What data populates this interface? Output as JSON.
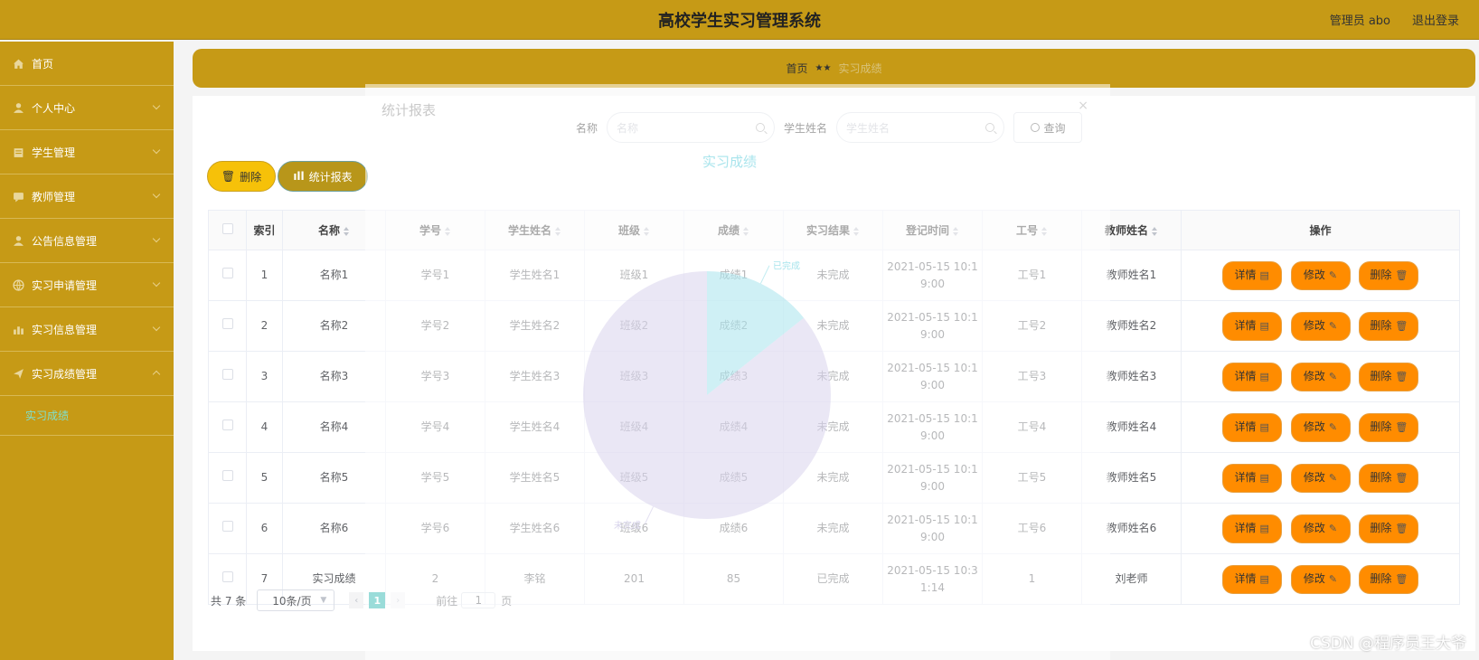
{
  "header": {
    "title": "高校学生实习管理系统",
    "user_label": "管理员 abo",
    "logout_label": "退出登录"
  },
  "sidebar": {
    "items": [
      {
        "label": "首页",
        "icon": "home-icon"
      },
      {
        "label": "个人中心",
        "icon": "user-icon"
      },
      {
        "label": "学生管理",
        "icon": "folder-icon"
      },
      {
        "label": "教师管理",
        "icon": "chat-icon"
      },
      {
        "label": "公告信息管理",
        "icon": "user-icon"
      },
      {
        "label": "实习申请管理",
        "icon": "globe-icon"
      },
      {
        "label": "实习信息管理",
        "icon": "chart-icon"
      },
      {
        "label": "实习成绩管理",
        "icon": "send-icon"
      }
    ],
    "submenu_active": "实习成绩"
  },
  "breadcrumb": {
    "home": "首页",
    "separator": "★★",
    "current": "实习成绩"
  },
  "search": {
    "name_label": "名称",
    "name_placeholder": "名称",
    "student_label": "学生姓名",
    "student_placeholder": "学生姓名",
    "query_button": "查询"
  },
  "toolbar": {
    "delete_label": "删除",
    "stats_label": "统计报表"
  },
  "table": {
    "columns": [
      "索引",
      "名称",
      "学号",
      "学生姓名",
      "班级",
      "成绩",
      "实习结果",
      "登记时间",
      "工号",
      "教师姓名",
      "操作"
    ],
    "rows": [
      {
        "index": "1",
        "name": "名称1",
        "student_no": "学号1",
        "student_name": "学生姓名1",
        "class": "班级1",
        "score": "成绩1",
        "result": "未完成",
        "time_1": "2021-05-15 10:1",
        "time_2": "9:00",
        "staff_no": "工号1",
        "teacher": "教师姓名1"
      },
      {
        "index": "2",
        "name": "名称2",
        "student_no": "学号2",
        "student_name": "学生姓名2",
        "class": "班级2",
        "score": "成绩2",
        "result": "未完成",
        "time_1": "2021-05-15 10:1",
        "time_2": "9:00",
        "staff_no": "工号2",
        "teacher": "教师姓名2"
      },
      {
        "index": "3",
        "name": "名称3",
        "student_no": "学号3",
        "student_name": "学生姓名3",
        "class": "班级3",
        "score": "成绩3",
        "result": "未完成",
        "time_1": "2021-05-15 10:1",
        "time_2": "9:00",
        "staff_no": "工号3",
        "teacher": "教师姓名3"
      },
      {
        "index": "4",
        "name": "名称4",
        "student_no": "学号4",
        "student_name": "学生姓名4",
        "class": "班级4",
        "score": "成绩4",
        "result": "未完成",
        "time_1": "2021-05-15 10:1",
        "time_2": "9:00",
        "staff_no": "工号4",
        "teacher": "教师姓名4"
      },
      {
        "index": "5",
        "name": "名称5",
        "student_no": "学号5",
        "student_name": "学生姓名5",
        "class": "班级5",
        "score": "成绩5",
        "result": "未完成",
        "time_1": "2021-05-15 10:1",
        "time_2": "9:00",
        "staff_no": "工号5",
        "teacher": "教师姓名5"
      },
      {
        "index": "6",
        "name": "名称6",
        "student_no": "学号6",
        "student_name": "学生姓名6",
        "class": "班级6",
        "score": "成绩6",
        "result": "未完成",
        "time_1": "2021-05-15 10:1",
        "time_2": "9:00",
        "staff_no": "工号6",
        "teacher": "教师姓名6"
      },
      {
        "index": "7",
        "name": "实习成绩",
        "student_no": "2",
        "student_name": "李铭",
        "class": "201",
        "score": "85",
        "result": "已完成",
        "time_1": "2021-05-15 10:3",
        "time_2": "1:14",
        "staff_no": "1",
        "teacher": "刘老师"
      }
    ],
    "actions": {
      "detail": "详情",
      "edit": "修改",
      "delete": "删除"
    }
  },
  "pagination": {
    "total": "共 7 条",
    "page_size": "10条/页",
    "current_page": "1",
    "goto_label": "前往",
    "goto_value": "1",
    "page_suffix": "页"
  },
  "dialog": {
    "title": "统计报表",
    "close": "×",
    "chart_title": "实习成绩",
    "chart_data": {
      "type": "pie",
      "title": "实习成绩",
      "slices": [
        {
          "name": "已完成",
          "value": 1,
          "color": "#a8e4ec"
        },
        {
          "name": "未完成",
          "value": 6,
          "color": "#d8d4ec"
        }
      ]
    }
  },
  "watermark": "CSDN @程序员王大爷",
  "colors": {
    "brand": "#c69a16",
    "accent": "#ff8c00",
    "active_page": "#20b2aa"
  }
}
